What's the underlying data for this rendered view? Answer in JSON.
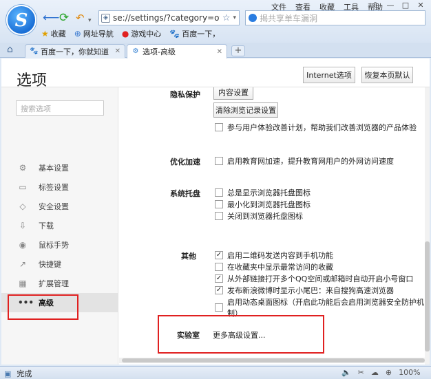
{
  "browser": {
    "logo_letter": "S",
    "menu": [
      "文件",
      "查看",
      "收藏",
      "工具",
      "帮助"
    ],
    "window_controls": [
      "⇩",
      "—",
      "□",
      "✕"
    ],
    "address": {
      "url": "se://settings/?category=othe"
    },
    "search": {
      "placeholder": "揭共享单车漏洞"
    },
    "favorites": [
      {
        "icon": "★",
        "label": "收藏"
      },
      {
        "icon": "⊕",
        "label": "网址导航"
      },
      {
        "icon": "●",
        "label": "游戏中心"
      },
      {
        "icon": "🐾",
        "label": "百度一下，"
      }
    ],
    "tabs": [
      {
        "icon": "🐾",
        "label": "百度一下，你就知道",
        "close": "✕"
      },
      {
        "icon": "⚙",
        "label": "选项-高级",
        "close": "✕"
      }
    ],
    "new_tab": "+"
  },
  "page": {
    "title": "选项",
    "internet_button": "Internet选项",
    "restore_button": "恢复本页默认",
    "search_placeholder": "搜索选项",
    "nav": [
      {
        "icon": "⚙",
        "label": "基本设置"
      },
      {
        "icon": "▭",
        "label": "标签设置"
      },
      {
        "icon": "◇",
        "label": "安全设置"
      },
      {
        "icon": "⇩",
        "label": "下载"
      },
      {
        "icon": "◉",
        "label": "鼠标手势"
      },
      {
        "icon": "↗",
        "label": "快捷键"
      },
      {
        "icon": "▦",
        "label": "扩展管理"
      },
      {
        "icon": "•••",
        "label": "高级"
      }
    ],
    "sections": {
      "privacy": {
        "label": "隐私保护",
        "content_settings": "内容设置",
        "clear_history": "清除浏览记录设置",
        "experience": "参与用户体验改善计划，帮助我们改善浏览器的产品体验"
      },
      "optimize": {
        "label": "优化加速",
        "edu": "启用教育网加速，提升教育网用户的外网访问速度"
      },
      "tray": {
        "label": "系统托盘",
        "items": [
          "总是显示浏览器托盘图标",
          "最小化到浏览器托盘图标",
          "关闭到浏览器托盘图标"
        ]
      },
      "other": {
        "label": "其他",
        "items": [
          {
            "text": "启用二维码发送内容到手机功能",
            "checked": "✓"
          },
          {
            "text": "在收藏夹中显示最常访问的收藏",
            "checked": ""
          },
          {
            "text": "从外部链接打开多个QQ空间或邮箱时自动开启小号窗口",
            "checked": "✓"
          },
          {
            "text": "发布新浪微博时显示小尾巴：来自搜狗高速浏览器",
            "checked": "✓"
          },
          {
            "text": "启用动态桌面图标（开启此功能后会启用浏览器安全防护机制）",
            "checked": ""
          }
        ]
      },
      "lab": {
        "label": "实验室",
        "link": "更多高级设置..."
      }
    }
  },
  "status": {
    "text": "完成",
    "zoom": "100%"
  }
}
